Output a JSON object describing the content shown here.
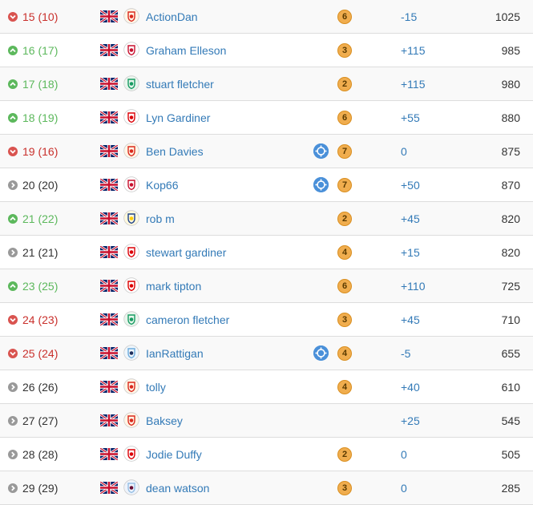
{
  "colors": {
    "up": "#5cb85c",
    "down": "#d9534f",
    "same": "#999999",
    "link": "#337ab7",
    "medal": "#f0ad4e",
    "chip": "#4a90d9"
  },
  "rows": [
    {
      "movement": "down",
      "rank": "15 (10)",
      "flag": "uk-flag",
      "club": "man-utd-crest",
      "name": "ActionDan",
      "chip": false,
      "medal": "6",
      "delta": "-15",
      "points": "1025"
    },
    {
      "movement": "up",
      "rank": "16 (17)",
      "flag": "uk-flag",
      "club": "liverpool-crest",
      "name": "Graham Elleson",
      "chip": false,
      "medal": "3",
      "delta": "+115",
      "points": "985"
    },
    {
      "movement": "up",
      "rank": "17 (18)",
      "flag": "uk-flag",
      "club": "celtic-crest",
      "name": "stuart fletcher",
      "chip": false,
      "medal": "2",
      "delta": "+115",
      "points": "980"
    },
    {
      "movement": "up",
      "rank": "18 (19)",
      "flag": "uk-flag",
      "club": "arsenal-crest",
      "name": "Lyn Gardiner",
      "chip": false,
      "medal": "6",
      "delta": "+55",
      "points": "880"
    },
    {
      "movement": "down",
      "rank": "19 (16)",
      "flag": "uk-flag",
      "club": "man-utd-crest",
      "name": "Ben Davies",
      "chip": true,
      "medal": "7",
      "delta": "0",
      "points": "875"
    },
    {
      "movement": "same",
      "rank": "20 (20)",
      "flag": "uk-flag",
      "club": "liverpool-crest",
      "name": "Kop66",
      "chip": true,
      "medal": "7",
      "delta": "+50",
      "points": "870"
    },
    {
      "movement": "up",
      "rank": "21 (22)",
      "flag": "uk-flag",
      "club": "leeds-crest",
      "name": "rob m",
      "chip": false,
      "medal": "2",
      "delta": "+45",
      "points": "820"
    },
    {
      "movement": "same",
      "rank": "21 (21)",
      "flag": "uk-flag",
      "club": "arsenal-crest",
      "name": "stewart gardiner",
      "chip": false,
      "medal": "4",
      "delta": "+15",
      "points": "820"
    },
    {
      "movement": "up",
      "rank": "23 (25)",
      "flag": "uk-flag",
      "club": "forest-crest",
      "name": "mark tipton",
      "chip": false,
      "medal": "6",
      "delta": "+110",
      "points": "725"
    },
    {
      "movement": "down",
      "rank": "24 (23)",
      "flag": "uk-flag",
      "club": "celtic-crest",
      "name": "cameron fletcher",
      "chip": false,
      "medal": "3",
      "delta": "+45",
      "points": "710"
    },
    {
      "movement": "down",
      "rank": "25 (24)",
      "flag": "uk-flag",
      "club": "man-city-crest",
      "name": "IanRattigan",
      "chip": true,
      "medal": "4",
      "delta": "-5",
      "points": "655"
    },
    {
      "movement": "same",
      "rank": "26 (26)",
      "flag": "uk-flag",
      "club": "man-utd-crest",
      "name": "tolly",
      "chip": false,
      "medal": "4",
      "delta": "+40",
      "points": "610"
    },
    {
      "movement": "same",
      "rank": "27 (27)",
      "flag": "uk-flag",
      "club": "man-utd-crest",
      "name": "Baksey",
      "chip": false,
      "medal": "",
      "delta": "+25",
      "points": "545"
    },
    {
      "movement": "same",
      "rank": "28 (28)",
      "flag": "uk-flag",
      "club": "arsenal-crest",
      "name": "Jodie Duffy",
      "chip": false,
      "medal": "2",
      "delta": "0",
      "points": "505"
    },
    {
      "movement": "same",
      "rank": "29 (29)",
      "flag": "uk-flag",
      "club": "aston-villa-crest",
      "name": "dean watson",
      "chip": false,
      "medal": "3",
      "delta": "0",
      "points": "285"
    }
  ]
}
